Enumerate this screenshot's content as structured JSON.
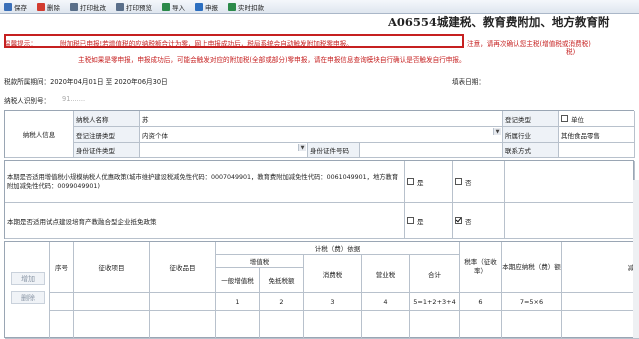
{
  "toolbar": {
    "items": [
      {
        "label": "保存",
        "icon": "save-icon",
        "color": "#3a6fb8"
      },
      {
        "label": "删除",
        "icon": "delete-icon",
        "color": "#d23b2f"
      },
      {
        "label": "打印批改",
        "icon": "print-icon",
        "color": "#5a6f8a"
      },
      {
        "label": "打印预览",
        "icon": "preview-icon",
        "color": "#5a6f8a"
      },
      {
        "label": "导入",
        "icon": "import-icon",
        "color": "#2c8a4a"
      },
      {
        "label": "申报",
        "icon": "declare-icon",
        "color": "#2d6fc0"
      },
      {
        "label": "实时扣款",
        "icon": "payment-icon",
        "color": "#2c8a4a"
      }
    ]
  },
  "form": {
    "title": "A06554城建税、教育费附加、地方教育附",
    "warning_prefix": "温馨提示：",
    "warning_line1": "附加税已申报!若增值税的应纳税额合计为零，网上申报成功后，税局系统会自动触发附加税零申报。",
    "warning_line1_tail": "注意，请再次确认您主税(增值税或消费税)",
    "warning_line1_tail2": "税)",
    "warning_line2": "主税如果是零申报，申报成功后，可能会触发对应的附加税(全部或部分)零申报，请在申报信息查询模块自行确认是否触发自行申报。",
    "period_label": "税款所属期间：2020年04月01日 至 2020年06月30日",
    "fill_date_label": "填表日期：",
    "taxpayer_id_label": "纳税人识别号：",
    "taxpayer_id_value": "91......."
  },
  "taxpayer": {
    "section_label": "纳税人信息",
    "name_label": "纳税人名称",
    "name_value": "苏",
    "reg_type_label": "登记注册类型",
    "reg_type_value": "内资个体",
    "id_type_label": "身份证件类型",
    "id_no_label": "身份证件号码",
    "reg_class_label": "登记类型",
    "reg_class_option": "单位",
    "industry_label": "所属行业",
    "industry_value": "其他食品零售",
    "contact_label": "联系方式"
  },
  "policy": {
    "q1": "本期是否适用增值税小规模纳税人优惠政策(城市维护建设税减免性代码：0007049901，教育费附加减免性代码：0061049901，地方教育附加减免性代码：0099049901)",
    "q2": "本期是否适用试点建设培育产教融合型企业抵免政策",
    "yes": "是",
    "no": "否"
  },
  "calc": {
    "add_btn": "增加",
    "del_btn": "删除",
    "seq": "序号",
    "item": "征收项目",
    "subitem": "征收品目",
    "basis_header": "计税（费）依据",
    "vat": "增值税",
    "vat_general": "一般增值税",
    "vat_exempt": "免抵税额",
    "consumption": "消费税",
    "business": "营业税",
    "total": "合计",
    "rate": "税率（征收率）",
    "payable": "本期应纳税（费）额",
    "cut": "减",
    "idx1": "1",
    "idx2": "2",
    "idx3": "3",
    "idx4": "4",
    "idx5": "5=1+2+3+4",
    "idx6": "6",
    "idx7": "7=5×6"
  },
  "colors": {
    "warning": "#c62020",
    "grid": "#b8c1cc",
    "shade": "#eef2f7"
  }
}
